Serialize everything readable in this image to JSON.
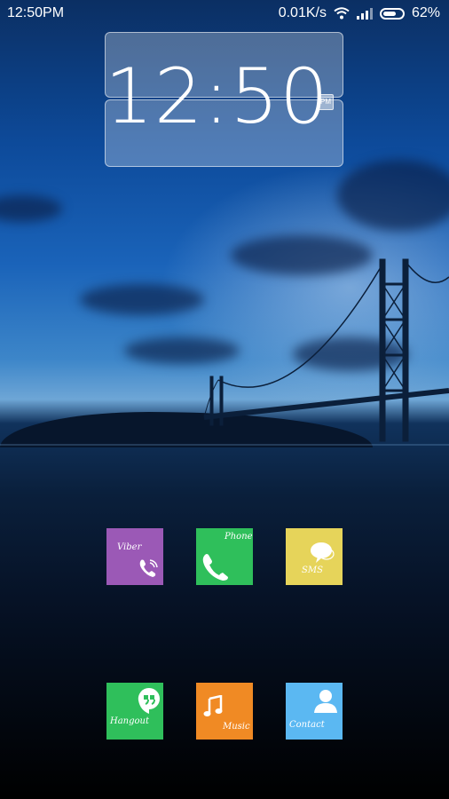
{
  "status_bar": {
    "time": "12:50PM",
    "network_speed": "0.01K/s",
    "battery_level": "62%",
    "icons": [
      "wifi-icon",
      "signal-icon",
      "battery-icon"
    ]
  },
  "clock_widget": {
    "time": "12:50",
    "ampm": "PM"
  },
  "tiles": [
    {
      "label": "Viber",
      "color": "#9b59b6",
      "icon": "viber-icon"
    },
    {
      "label": "Phone",
      "color": "#2fbf5b",
      "icon": "phone-icon"
    },
    {
      "label": "SMS",
      "color": "#e6d45a",
      "icon": "sms-icon"
    },
    {
      "label": "Hangout",
      "color": "#2fbf5b",
      "icon": "hangouts-icon"
    },
    {
      "label": "Music",
      "color": "#f08a24",
      "icon": "music-icon"
    },
    {
      "label": "Contact",
      "color": "#5bb8f2",
      "icon": "contact-icon"
    }
  ]
}
